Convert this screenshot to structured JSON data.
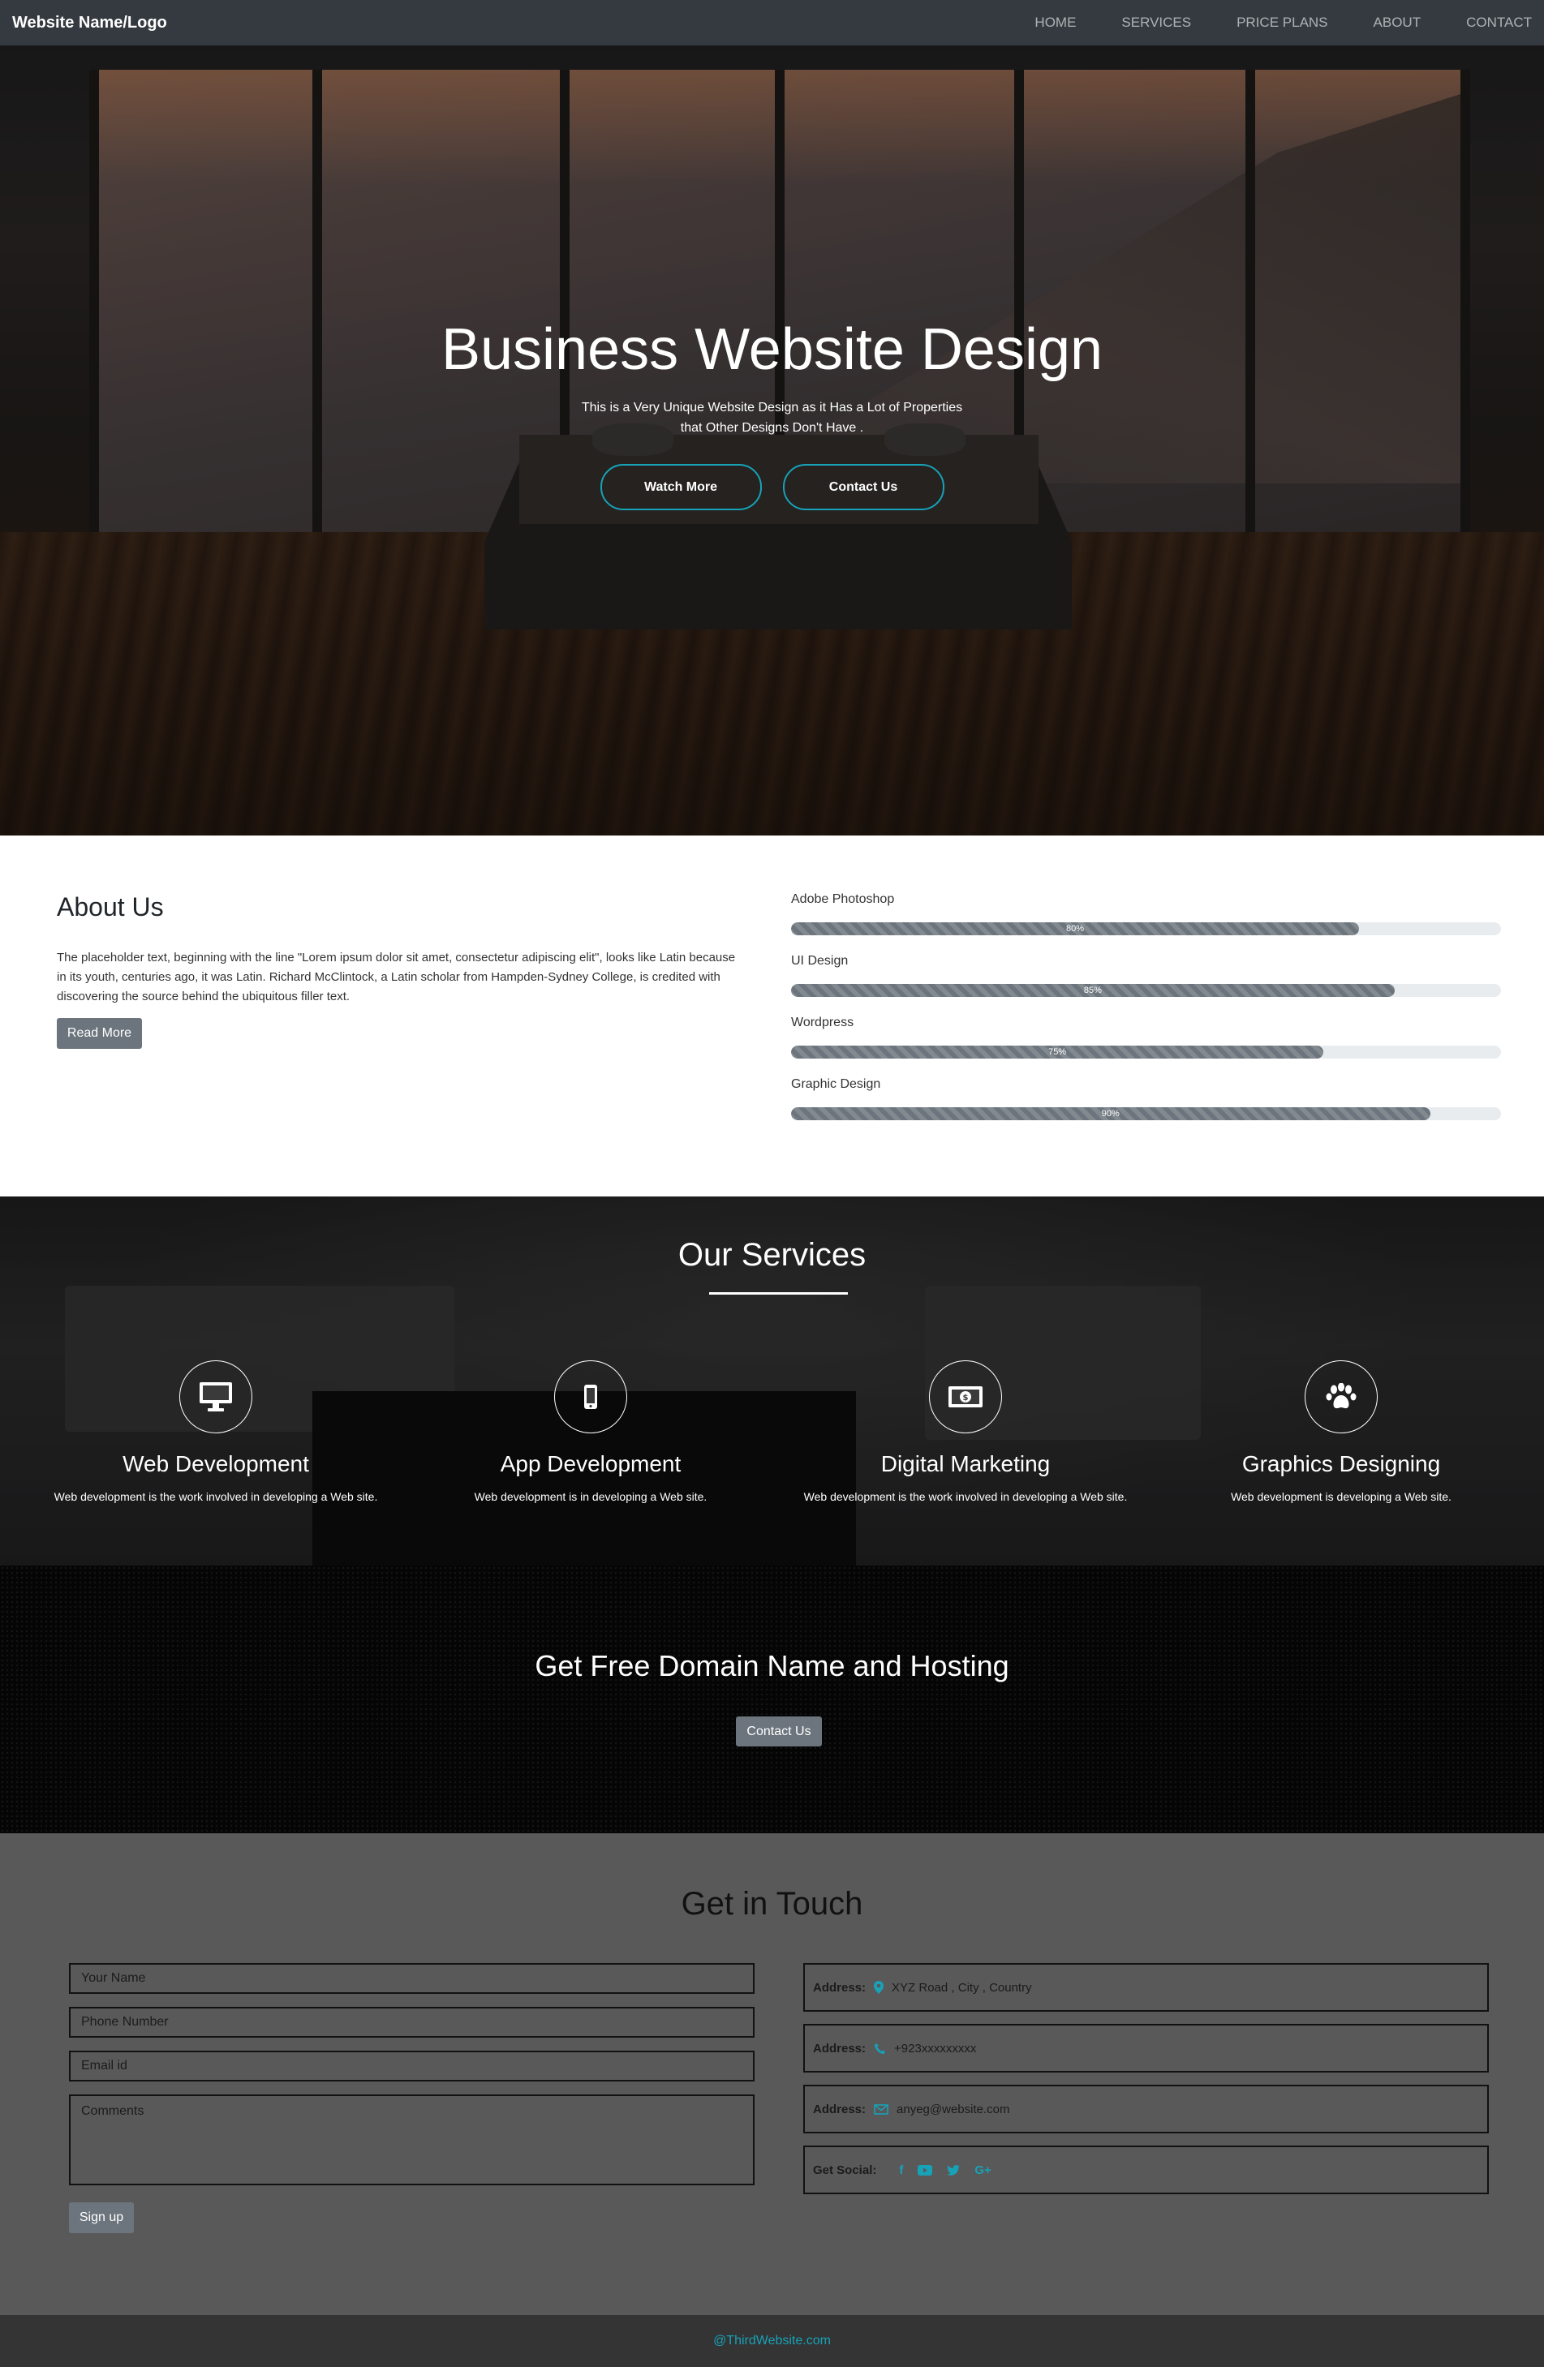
{
  "navbar": {
    "brand": "Website Name/Logo",
    "links": [
      "HOME",
      "SERVICES",
      "PRICE PLANS",
      "ABOUT",
      "CONTACT"
    ]
  },
  "hero": {
    "title": "Business Website Design",
    "subtitle_line1": "This is a Very Unique Website Design as it Has a Lot of Properties",
    "subtitle_line2": "that Other Designs Don't Have .",
    "watch_more_label": "Watch More",
    "contact_label": "Contact Us"
  },
  "about": {
    "title": "About Us",
    "text": "The placeholder text, beginning with the line \"Lorem ipsum dolor sit amet, consectetur adipiscing elit\", looks like Latin because in its youth, centuries ago, it was Latin. Richard McClintock, a Latin scholar from Hampden-Sydney College, is credited with discovering the source behind the ubiquitous filler text.",
    "read_more_label": "Read More",
    "skills": [
      {
        "label": "Adobe Photoshop",
        "percent": 80,
        "percent_label": "80%"
      },
      {
        "label": "UI Design",
        "percent": 85,
        "percent_label": "85%"
      },
      {
        "label": "Wordpress",
        "percent": 75,
        "percent_label": "75%"
      },
      {
        "label": "Graphic Design",
        "percent": 90,
        "percent_label": "90%"
      }
    ]
  },
  "services": {
    "title": "Our Services",
    "items": [
      {
        "icon": "desktop-icon",
        "name": "Web Development",
        "desc": "Web development is the work involved in developing a Web site."
      },
      {
        "icon": "mobile-icon",
        "name": "App Development",
        "desc": "Web development is in developing a Web site."
      },
      {
        "icon": "money-icon",
        "name": "Digital Marketing",
        "desc": "Web development is the work involved in developing a Web site."
      },
      {
        "icon": "paw-icon",
        "name": "Graphics Designing",
        "desc": "Web development is developing a Web site."
      }
    ]
  },
  "domain": {
    "title": "Get Free Domain Name and Hosting",
    "button_label": "Contact Us"
  },
  "contact": {
    "title": "Get in Touch",
    "name_placeholder": "Your Name",
    "phone_placeholder": "Phone Number",
    "email_placeholder": "Email id",
    "comments_placeholder": "Comments",
    "signup_label": "Sign up",
    "address_label": "Address:",
    "address_value": "XYZ Road , City , Country",
    "phone_label": "Address:",
    "phone_value": "+923xxxxxxxxx",
    "email_label": "Address:",
    "email_value": "anyeg@website.com",
    "social_label": "Get Social:",
    "social_icons": [
      "facebook-icon",
      "youtube-icon",
      "twitter-icon",
      "google-plus-icon"
    ]
  },
  "footer": {
    "text": "@ThirdWebsite.com"
  },
  "colors": {
    "navbar": "#343a40",
    "accent": "#17a2b8",
    "button_grey": "#6c757d",
    "contact_bg": "#595959",
    "footer_bg": "#343434"
  }
}
